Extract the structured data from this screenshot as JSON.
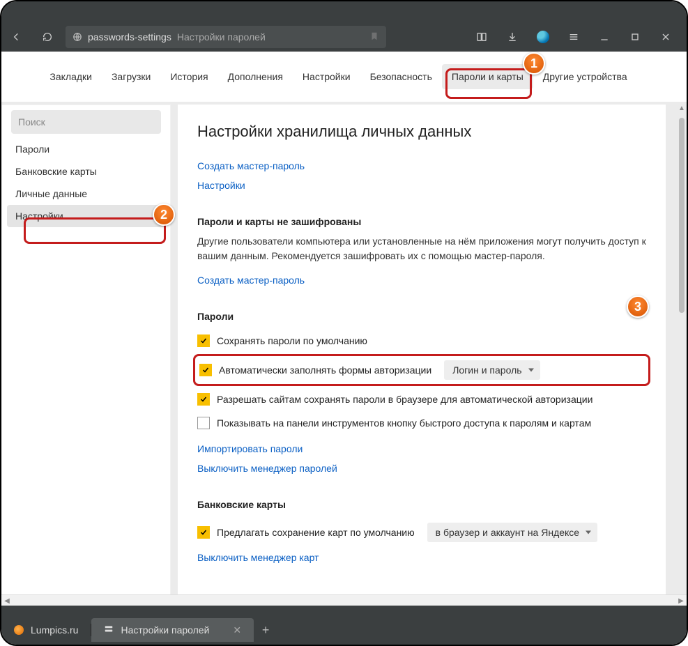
{
  "chrome": {
    "url": "passwords-settings",
    "page_title": "Настройки паролей"
  },
  "nav": {
    "items": [
      "Закладки",
      "Загрузки",
      "История",
      "Дополнения",
      "Настройки",
      "Безопасность",
      "Пароли и карты",
      "Другие устройства"
    ]
  },
  "sidebar": {
    "search_placeholder": "Поиск",
    "items": [
      "Пароли",
      "Банковские карты",
      "Личные данные",
      "Настройки"
    ]
  },
  "main": {
    "title": "Настройки хранилища личных данных",
    "links_top": [
      "Создать мастер-пароль",
      "Настройки"
    ],
    "section_unencrypted": {
      "heading": "Пароли и карты не зашифрованы",
      "desc": "Другие пользователи компьютера или установленные на нём приложения могут получить доступ к вашим данным. Рекомендуется зашифровать их с помощью мастер-пароля.",
      "link": "Создать мастер-пароль"
    },
    "passwords": {
      "heading": "Пароли",
      "rows": {
        "row0": {
          "checked": true,
          "label": "Сохранять пароли по умолчанию"
        },
        "row1": {
          "checked": true,
          "label": "Автоматически заполнять формы авторизации",
          "select": "Логин и пароль"
        },
        "row2": {
          "checked": true,
          "label": "Разрешать сайтам сохранять пароли в браузере для автоматической авторизации"
        },
        "row3": {
          "checked": false,
          "label": "Показывать на панели инструментов кнопку быстрого доступа к паролям и картам"
        }
      },
      "links": [
        "Импортировать пароли",
        "Выключить менеджер паролей"
      ]
    },
    "cards": {
      "heading": "Банковские карты",
      "row": {
        "checked": true,
        "label": "Предлагать сохранение карт по умолчанию",
        "select": "в браузер и аккаунт на Яндексе"
      },
      "link": "Выключить менеджер карт"
    }
  },
  "tabs": {
    "tab1": "Lumpics.ru",
    "tab2": "Настройки паролей"
  },
  "callouts": {
    "c1": "1",
    "c2": "2",
    "c3": "3"
  }
}
